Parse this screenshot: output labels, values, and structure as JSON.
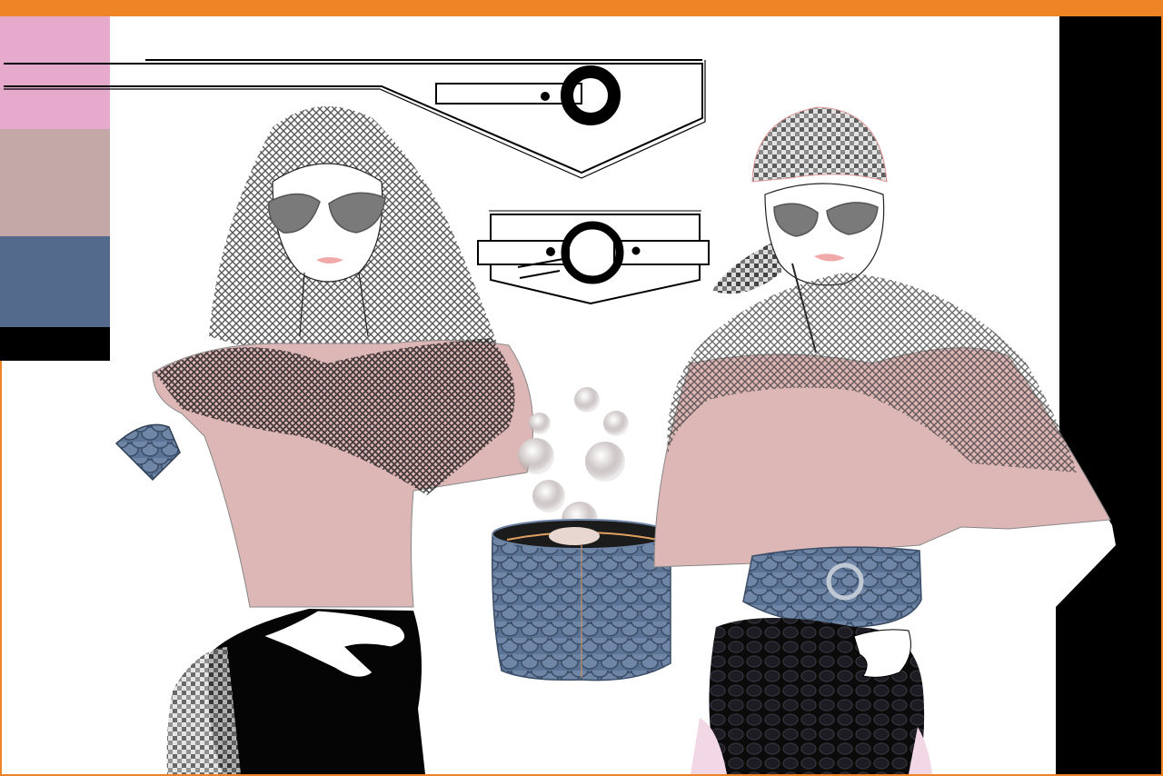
{
  "palette": {
    "frame": "#EF8427",
    "background": "#FFFFFF",
    "side_panel": "#000000",
    "swatches": [
      "#E6AACC",
      "#C4A8A8",
      "#536A8C",
      "#000000"
    ]
  },
  "garment_colors": {
    "top": "#DDB6B6",
    "mesh": "#5C5C5C",
    "denim_leather": "#5B7395",
    "shorts": "#050505",
    "lens": "#7A7A7A",
    "lips": "#F0A8A8",
    "tights": "#F2D8E4"
  },
  "figures": [
    {
      "name": "left-model",
      "items": [
        "mesh-hood",
        "oval-sunglasses",
        "crop-top",
        "black-shorts"
      ]
    },
    {
      "name": "right-model",
      "items": [
        "knit-cap",
        "mask-sunglasses",
        "cape-top",
        "ring-belt",
        "black-shorts"
      ]
    }
  ],
  "accessories": [
    "belt-flat-large",
    "belt-flat-small",
    "bucket-bag",
    "cuff-bracelet"
  ]
}
